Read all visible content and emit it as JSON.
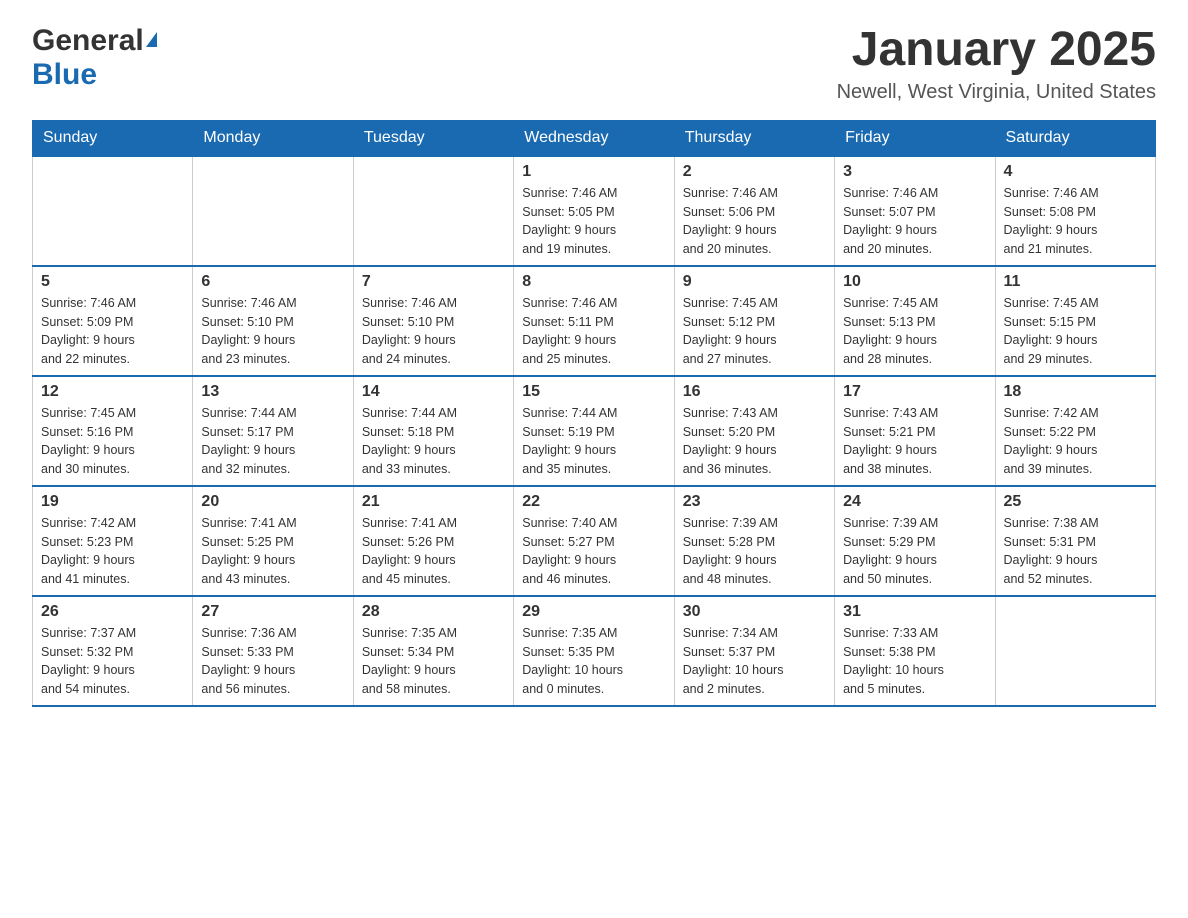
{
  "header": {
    "logo_general": "General",
    "logo_blue": "Blue",
    "month_title": "January 2025",
    "location": "Newell, West Virginia, United States"
  },
  "weekdays": [
    "Sunday",
    "Monday",
    "Tuesday",
    "Wednesday",
    "Thursday",
    "Friday",
    "Saturday"
  ],
  "weeks": [
    [
      {
        "day": "",
        "info": ""
      },
      {
        "day": "",
        "info": ""
      },
      {
        "day": "",
        "info": ""
      },
      {
        "day": "1",
        "info": "Sunrise: 7:46 AM\nSunset: 5:05 PM\nDaylight: 9 hours\nand 19 minutes."
      },
      {
        "day": "2",
        "info": "Sunrise: 7:46 AM\nSunset: 5:06 PM\nDaylight: 9 hours\nand 20 minutes."
      },
      {
        "day": "3",
        "info": "Sunrise: 7:46 AM\nSunset: 5:07 PM\nDaylight: 9 hours\nand 20 minutes."
      },
      {
        "day": "4",
        "info": "Sunrise: 7:46 AM\nSunset: 5:08 PM\nDaylight: 9 hours\nand 21 minutes."
      }
    ],
    [
      {
        "day": "5",
        "info": "Sunrise: 7:46 AM\nSunset: 5:09 PM\nDaylight: 9 hours\nand 22 minutes."
      },
      {
        "day": "6",
        "info": "Sunrise: 7:46 AM\nSunset: 5:10 PM\nDaylight: 9 hours\nand 23 minutes."
      },
      {
        "day": "7",
        "info": "Sunrise: 7:46 AM\nSunset: 5:10 PM\nDaylight: 9 hours\nand 24 minutes."
      },
      {
        "day": "8",
        "info": "Sunrise: 7:46 AM\nSunset: 5:11 PM\nDaylight: 9 hours\nand 25 minutes."
      },
      {
        "day": "9",
        "info": "Sunrise: 7:45 AM\nSunset: 5:12 PM\nDaylight: 9 hours\nand 27 minutes."
      },
      {
        "day": "10",
        "info": "Sunrise: 7:45 AM\nSunset: 5:13 PM\nDaylight: 9 hours\nand 28 minutes."
      },
      {
        "day": "11",
        "info": "Sunrise: 7:45 AM\nSunset: 5:15 PM\nDaylight: 9 hours\nand 29 minutes."
      }
    ],
    [
      {
        "day": "12",
        "info": "Sunrise: 7:45 AM\nSunset: 5:16 PM\nDaylight: 9 hours\nand 30 minutes."
      },
      {
        "day": "13",
        "info": "Sunrise: 7:44 AM\nSunset: 5:17 PM\nDaylight: 9 hours\nand 32 minutes."
      },
      {
        "day": "14",
        "info": "Sunrise: 7:44 AM\nSunset: 5:18 PM\nDaylight: 9 hours\nand 33 minutes."
      },
      {
        "day": "15",
        "info": "Sunrise: 7:44 AM\nSunset: 5:19 PM\nDaylight: 9 hours\nand 35 minutes."
      },
      {
        "day": "16",
        "info": "Sunrise: 7:43 AM\nSunset: 5:20 PM\nDaylight: 9 hours\nand 36 minutes."
      },
      {
        "day": "17",
        "info": "Sunrise: 7:43 AM\nSunset: 5:21 PM\nDaylight: 9 hours\nand 38 minutes."
      },
      {
        "day": "18",
        "info": "Sunrise: 7:42 AM\nSunset: 5:22 PM\nDaylight: 9 hours\nand 39 minutes."
      }
    ],
    [
      {
        "day": "19",
        "info": "Sunrise: 7:42 AM\nSunset: 5:23 PM\nDaylight: 9 hours\nand 41 minutes."
      },
      {
        "day": "20",
        "info": "Sunrise: 7:41 AM\nSunset: 5:25 PM\nDaylight: 9 hours\nand 43 minutes."
      },
      {
        "day": "21",
        "info": "Sunrise: 7:41 AM\nSunset: 5:26 PM\nDaylight: 9 hours\nand 45 minutes."
      },
      {
        "day": "22",
        "info": "Sunrise: 7:40 AM\nSunset: 5:27 PM\nDaylight: 9 hours\nand 46 minutes."
      },
      {
        "day": "23",
        "info": "Sunrise: 7:39 AM\nSunset: 5:28 PM\nDaylight: 9 hours\nand 48 minutes."
      },
      {
        "day": "24",
        "info": "Sunrise: 7:39 AM\nSunset: 5:29 PM\nDaylight: 9 hours\nand 50 minutes."
      },
      {
        "day": "25",
        "info": "Sunrise: 7:38 AM\nSunset: 5:31 PM\nDaylight: 9 hours\nand 52 minutes."
      }
    ],
    [
      {
        "day": "26",
        "info": "Sunrise: 7:37 AM\nSunset: 5:32 PM\nDaylight: 9 hours\nand 54 minutes."
      },
      {
        "day": "27",
        "info": "Sunrise: 7:36 AM\nSunset: 5:33 PM\nDaylight: 9 hours\nand 56 minutes."
      },
      {
        "day": "28",
        "info": "Sunrise: 7:35 AM\nSunset: 5:34 PM\nDaylight: 9 hours\nand 58 minutes."
      },
      {
        "day": "29",
        "info": "Sunrise: 7:35 AM\nSunset: 5:35 PM\nDaylight: 10 hours\nand 0 minutes."
      },
      {
        "day": "30",
        "info": "Sunrise: 7:34 AM\nSunset: 5:37 PM\nDaylight: 10 hours\nand 2 minutes."
      },
      {
        "day": "31",
        "info": "Sunrise: 7:33 AM\nSunset: 5:38 PM\nDaylight: 10 hours\nand 5 minutes."
      },
      {
        "day": "",
        "info": ""
      }
    ]
  ]
}
